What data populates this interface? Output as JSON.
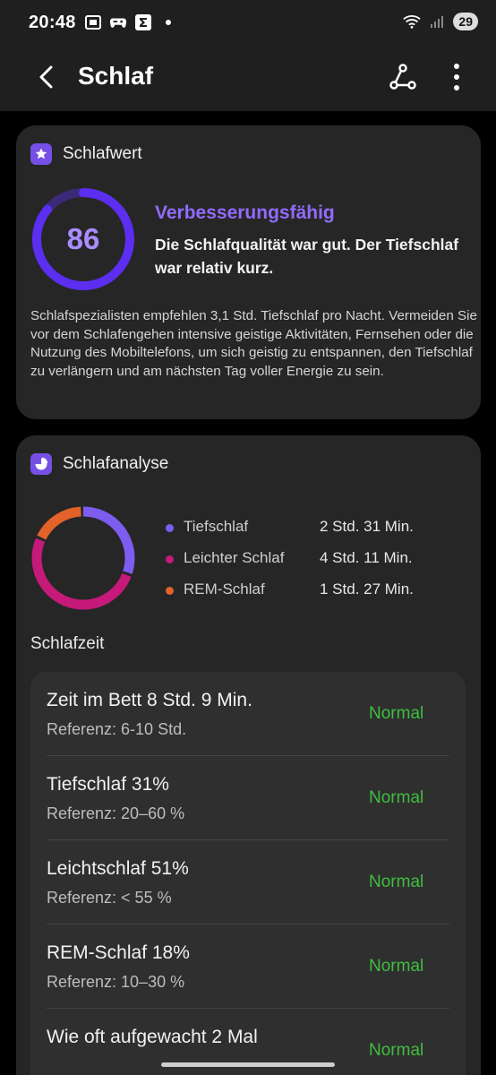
{
  "status_bar": {
    "time": "20:48",
    "left_icons": [
      "screenshot-icon",
      "game-controller-icon",
      "sigma-app-icon",
      "dot-icon"
    ],
    "right_icons": [
      "wifi-icon",
      "signal-icon"
    ],
    "battery": "29"
  },
  "app_bar": {
    "title": "Schlaf",
    "back_icon": "chevron-left-icon",
    "share_icon": "share-icon",
    "more_icon": "more-vertical-icon"
  },
  "score_card": {
    "title": "Schlafwert",
    "icon": "star-badge-icon",
    "score": "86",
    "score_fraction": 0.86,
    "rating": "Verbesserungsfähig",
    "summary": "Die Schlafqualität war gut. Der Tiefschlaf war relativ kurz.",
    "advice": "Schlafspezialisten empfehlen 3,1 Std. Tiefschlaf pro Nacht. Vermeiden Sie vor dem Schlafengehen intensive geistige Aktivitäten, Fernsehen oder die Nutzung des Mobiltelefons, um sich geistig zu entspannen, den Tiefschlaf zu verlängern und am nächsten Tag voller Energie zu sein."
  },
  "analysis_card": {
    "title": "Schlafanalyse",
    "icon": "pie-chart-icon",
    "stages": [
      {
        "label": "Tiefschlaf",
        "value": "2 Std. 31 Min.",
        "minutes": 151,
        "color": "#7d5cf0"
      },
      {
        "label": "Leichter Schlaf",
        "value": "4 Std. 11 Min.",
        "minutes": 251,
        "color": "#c51a7a"
      },
      {
        "label": "REM-Schlaf",
        "value": "1 Std. 27 Min.",
        "minutes": 87,
        "color": "#e2622a"
      }
    ],
    "section_title": "Schlafzeit",
    "metrics": [
      {
        "title": "Zeit im Bett 8 Std. 9 Min.",
        "reference": "Referenz: 6-10 Std.",
        "status": "Normal"
      },
      {
        "title": "Tiefschlaf 31%",
        "reference": "Referenz: 20–60 %",
        "status": "Normal"
      },
      {
        "title": "Leichtschlaf 51%",
        "reference": "Referenz: < 55 %",
        "status": "Normal"
      },
      {
        "title": "REM-Schlaf 18%",
        "reference": "Referenz: 10–30 %",
        "status": "Normal"
      },
      {
        "title": "Wie oft aufgewacht 2 Mal",
        "reference": "",
        "status": "Normal"
      }
    ]
  },
  "colors": {
    "accent": "#7650e6",
    "score_ring": "#5b2ef0",
    "normal": "#3fbe3f"
  }
}
